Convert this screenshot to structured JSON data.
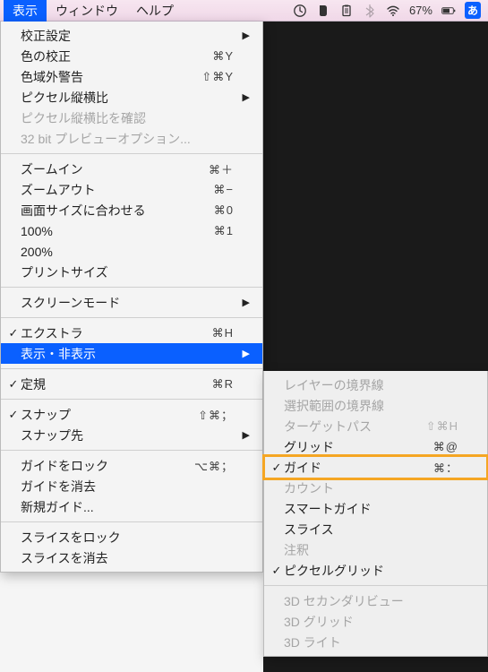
{
  "menubar": {
    "items": [
      {
        "label": "表示",
        "active": true
      },
      {
        "label": "ウィンドウ",
        "active": false
      },
      {
        "label": "ヘルプ",
        "active": false
      }
    ],
    "battery": "67%",
    "ime": "あ"
  },
  "main_menu": [
    {
      "label": "校正設定",
      "arrow": true
    },
    {
      "label": "色の校正",
      "shortcut": "⌘Y"
    },
    {
      "label": "色域外警告",
      "shortcut": "⇧⌘Y"
    },
    {
      "label": "ピクセル縦横比",
      "arrow": true
    },
    {
      "label": "ピクセル縦横比を確認",
      "disabled": true
    },
    {
      "label": "32 bit プレビューオプション...",
      "disabled": true
    },
    {
      "sep": true
    },
    {
      "label": "ズームイン",
      "shortcut": "⌘＋"
    },
    {
      "label": "ズームアウト",
      "shortcut": "⌘−"
    },
    {
      "label": "画面サイズに合わせる",
      "shortcut": "⌘0"
    },
    {
      "label": "100%",
      "shortcut": "⌘1"
    },
    {
      "label": "200%"
    },
    {
      "label": "プリントサイズ"
    },
    {
      "sep": true
    },
    {
      "label": "スクリーンモード",
      "arrow": true
    },
    {
      "sep": true
    },
    {
      "label": "エクストラ",
      "check": true,
      "shortcut": "⌘H"
    },
    {
      "label": "表示・非表示",
      "arrow": true,
      "selected": true
    },
    {
      "sep": true
    },
    {
      "label": "定規",
      "check": true,
      "shortcut": "⌘R"
    },
    {
      "sep": true
    },
    {
      "label": "スナップ",
      "check": true,
      "shortcut": "⇧⌘；"
    },
    {
      "label": "スナップ先",
      "arrow": true
    },
    {
      "sep": true
    },
    {
      "label": "ガイドをロック",
      "shortcut": "⌥⌘；"
    },
    {
      "label": "ガイドを消去"
    },
    {
      "label": "新規ガイド..."
    },
    {
      "sep": true
    },
    {
      "label": "スライスをロック"
    },
    {
      "label": "スライスを消去"
    }
  ],
  "sub_menu": [
    {
      "label": "レイヤーの境界線",
      "disabled": true
    },
    {
      "label": "選択範囲の境界線",
      "disabled": true
    },
    {
      "label": "ターゲットパス",
      "disabled": true,
      "shortcut": "⇧⌘H"
    },
    {
      "label": "グリッド",
      "shortcut": "⌘@"
    },
    {
      "label": "ガイド",
      "check": true,
      "shortcut": "⌘：",
      "highlight": true
    },
    {
      "label": "カウント",
      "disabled": true
    },
    {
      "label": "スマートガイド"
    },
    {
      "label": "スライス"
    },
    {
      "label": "注釈",
      "disabled": true
    },
    {
      "label": "ピクセルグリッド",
      "check": true
    },
    {
      "sep": true
    },
    {
      "label": "3D セカンダリビュー",
      "disabled": true
    },
    {
      "label": "3D グリッド",
      "disabled": true
    },
    {
      "label": "3D ライト",
      "disabled": true
    }
  ]
}
